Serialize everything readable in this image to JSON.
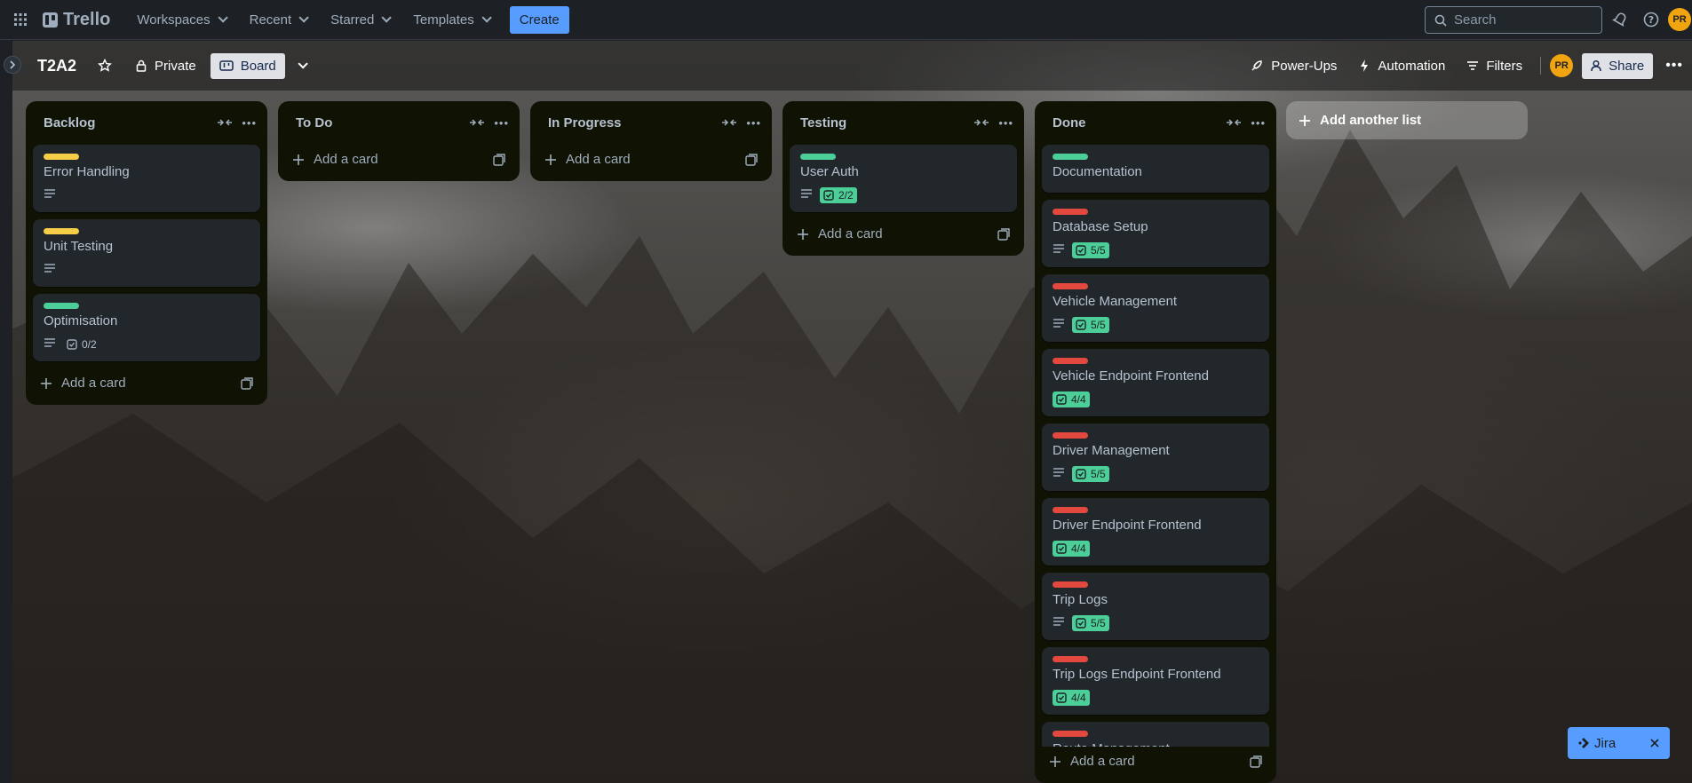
{
  "nav": {
    "app_name": "Trello",
    "menus": [
      "Workspaces",
      "Recent",
      "Starred",
      "Templates"
    ],
    "create_label": "Create",
    "search_placeholder": "Search",
    "avatar_initials": "PR"
  },
  "board": {
    "title": "T2A2",
    "visibility_label": "Private",
    "view_label": "Board",
    "power_ups_label": "Power-Ups",
    "automation_label": "Automation",
    "filters_label": "Filters",
    "share_label": "Share",
    "avatar_initials": "PR",
    "add_list_label": "Add another list"
  },
  "lists": [
    {
      "title": "Backlog",
      "add_card_label": "Add a card",
      "cards": [
        {
          "label_color": "yellow",
          "title": "Error Handling",
          "description": true,
          "checklist": null
        },
        {
          "label_color": "yellow",
          "title": "Unit Testing",
          "description": true,
          "checklist": null
        },
        {
          "label_color": "green",
          "title": "Optimisation",
          "description": true,
          "checklist": "0/2",
          "checklist_done": false
        }
      ]
    },
    {
      "title": "To Do",
      "add_card_label": "Add a card",
      "cards": []
    },
    {
      "title": "In Progress",
      "add_card_label": "Add a card",
      "cards": []
    },
    {
      "title": "Testing",
      "add_card_label": "Add a card",
      "cards": [
        {
          "label_color": "green",
          "title": "User Auth",
          "description": true,
          "checklist": "2/2",
          "checklist_done": true
        }
      ]
    },
    {
      "title": "Done",
      "add_card_label": "Add a card",
      "cards": [
        {
          "label_color": "green",
          "title": "Documentation",
          "description": false,
          "checklist": null
        },
        {
          "label_color": "red",
          "title": "Database Setup",
          "description": true,
          "checklist": "5/5",
          "checklist_done": true
        },
        {
          "label_color": "red",
          "title": "Vehicle Management",
          "description": true,
          "checklist": "5/5",
          "checklist_done": true
        },
        {
          "label_color": "red",
          "title": "Vehicle Endpoint Frontend",
          "description": false,
          "checklist": "4/4",
          "checklist_done": true
        },
        {
          "label_color": "red",
          "title": "Driver Management",
          "description": true,
          "checklist": "5/5",
          "checklist_done": true
        },
        {
          "label_color": "red",
          "title": "Driver Endpoint Frontend",
          "description": false,
          "checklist": "4/4",
          "checklist_done": true
        },
        {
          "label_color": "red",
          "title": "Trip Logs",
          "description": true,
          "checklist": "5/5",
          "checklist_done": true
        },
        {
          "label_color": "red",
          "title": "Trip Logs Endpoint Frontend",
          "description": false,
          "checklist": "4/4",
          "checklist_done": true
        },
        {
          "label_color": "red",
          "title": "Route Management",
          "description": false,
          "checklist": null
        }
      ]
    }
  ],
  "jira": {
    "label": "Jira"
  },
  "colors": {
    "accent": "#579dff",
    "label_yellow": "#f5cd47",
    "label_green": "#4bce97",
    "label_red": "#e2483d"
  }
}
